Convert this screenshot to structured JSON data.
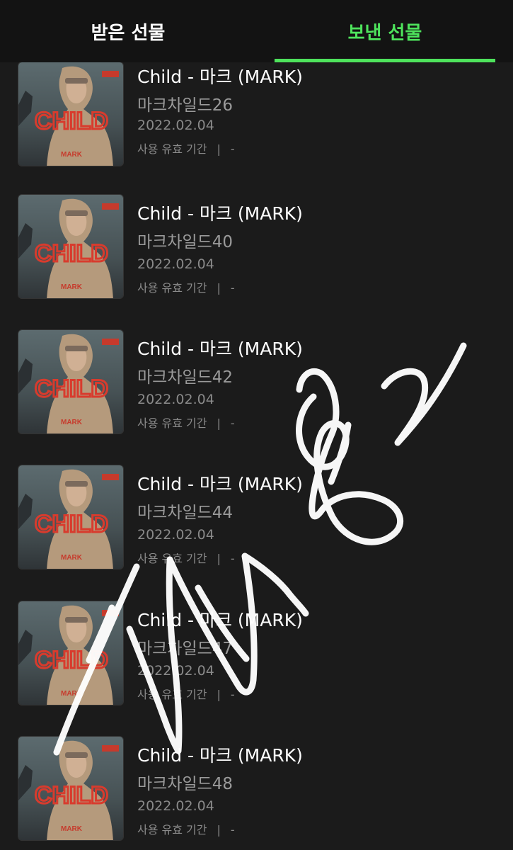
{
  "tabs": {
    "received_label": "받은 선물",
    "sent_label": "보낸 선물",
    "active": "sent"
  },
  "colors": {
    "accent": "#4ee35c",
    "background": "#1b1b1b",
    "tabbar": "#131313"
  },
  "album": {
    "cover_title": "CHILD",
    "cover_artist": "MARK"
  },
  "gifts": [
    {
      "title": "Child - 마크 (MARK)",
      "name": "마크차일드26",
      "date": "2022.02.04",
      "validity_label": "사용 유효 기간",
      "validity_sep": "|",
      "validity_value": "-"
    },
    {
      "title": "Child - 마크 (MARK)",
      "name": "마크차일드40",
      "date": "2022.02.04",
      "validity_label": "사용 유효 기간",
      "validity_sep": "|",
      "validity_value": "-"
    },
    {
      "title": "Child - 마크 (MARK)",
      "name": "마크차일드42",
      "date": "2022.02.04",
      "validity_label": "사용 유효 기간",
      "validity_sep": "|",
      "validity_value": "-"
    },
    {
      "title": "Child - 마크 (MARK)",
      "name": "마크차일드44",
      "date": "2022.02.04",
      "validity_label": "사용 유효 기간",
      "validity_sep": "|",
      "validity_value": "-"
    },
    {
      "title": "Child - 마크 (MARK)",
      "name": "마크차일드47",
      "date": "2022.02.04",
      "validity_label": "사용 유효 기간",
      "validity_sep": "|",
      "validity_value": "-"
    },
    {
      "title": "Child - 마크 (MARK)",
      "name": "마크차일드48",
      "date": "2022.02.04",
      "validity_label": "사용 유효 기간",
      "validity_sep": "|",
      "validity_value": "-"
    }
  ]
}
